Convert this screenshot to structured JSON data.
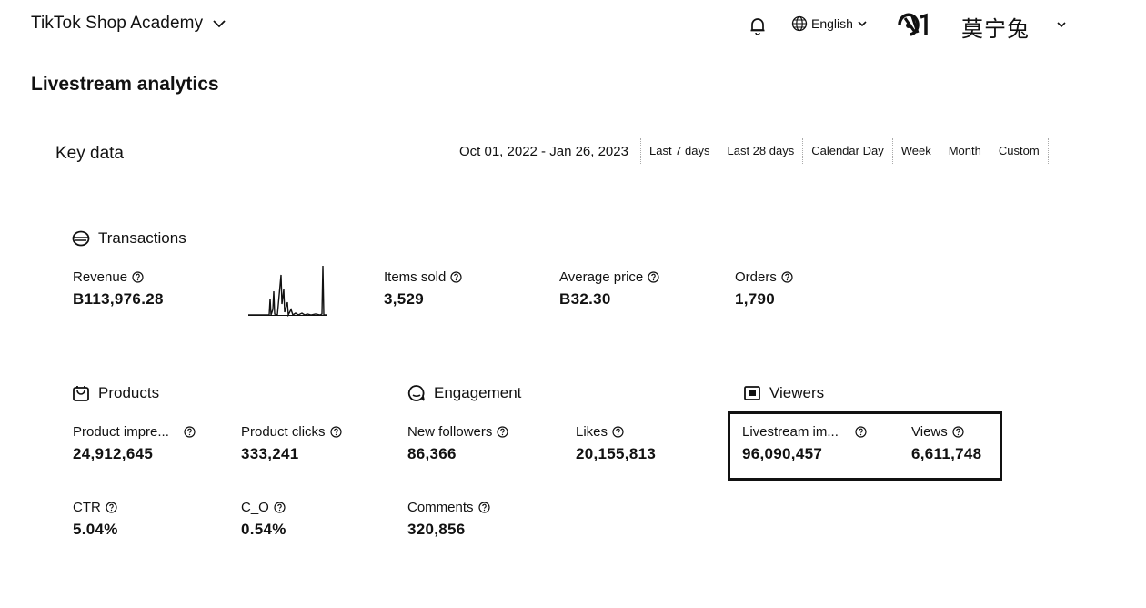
{
  "header": {
    "brand": "TikTok Shop Academy",
    "language": "English",
    "username": "莫宁兔"
  },
  "page": {
    "title": "Livestream analytics"
  },
  "key_data": {
    "title": "Key data",
    "date_range": "Oct 01, 2022 - Jan 26, 2023",
    "range_tabs": [
      "Last 7 days",
      "Last 28 days",
      "Calendar Day",
      "Week",
      "Month",
      "Custom"
    ]
  },
  "transactions": {
    "title": "Transactions",
    "revenue": {
      "label": "Revenue",
      "value": "B113,976.28"
    },
    "items_sold": {
      "label": "Items sold",
      "value": "3,529"
    },
    "average_price": {
      "label": "Average price",
      "value": "B32.30"
    },
    "orders": {
      "label": "Orders",
      "value": "1,790"
    }
  },
  "products": {
    "title": "Products",
    "impressions": {
      "label": "Product impre...",
      "value": "24,912,645"
    },
    "clicks": {
      "label": "Product clicks",
      "value": "333,241"
    },
    "ctr": {
      "label": "CTR",
      "value": "5.04%"
    },
    "c_o": {
      "label": "C_O",
      "value": "0.54%"
    }
  },
  "engagement": {
    "title": "Engagement",
    "new_followers": {
      "label": "New followers",
      "value": "86,366"
    },
    "likes": {
      "label": "Likes",
      "value": "20,155,813"
    },
    "comments": {
      "label": "Comments",
      "value": "320,856"
    }
  },
  "viewers": {
    "title": "Viewers",
    "livestream_impressions": {
      "label": "Livestream im...",
      "value": "96,090,457"
    },
    "views": {
      "label": "Views",
      "value": "6,611,748"
    }
  },
  "icons": {
    "brand_chevron": "chevron-down-icon",
    "bell": "bell-icon",
    "globe": "globe-icon",
    "help": "help-circle-icon",
    "transactions": "wallet-icon",
    "products": "shopping-bag-icon",
    "engagement": "chat-bubble-icon",
    "viewers": "screen-icon"
  },
  "colors": {
    "text": "#111111",
    "background": "#ffffff"
  }
}
